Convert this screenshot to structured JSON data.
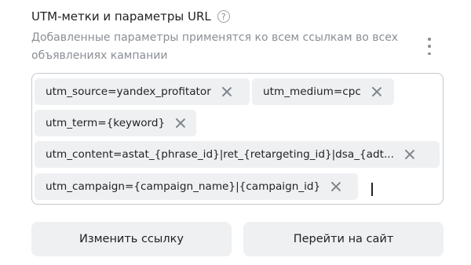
{
  "section": {
    "title": "UTM-метки и параметры URL",
    "help_icon": "question-circle-icon",
    "description": "Добавленные параметры применятся ко всем ссылкам во всех объявлениях кампании",
    "more_icon": "vertical-dots-icon"
  },
  "tags": [
    {
      "label": "utm_source=yandex_profitator"
    },
    {
      "label": "utm_medium=cpc"
    },
    {
      "label": "utm_term={keyword}"
    },
    {
      "label": "utm_content=astat_{phrase_id}|ret_{retargeting_id}|dsa_{adt..."
    },
    {
      "label": "utm_campaign={campaign_name}|{campaign_id}"
    }
  ],
  "buttons": {
    "edit_link": "Изменить ссылку",
    "go_to_site": "Перейти на сайт"
  }
}
